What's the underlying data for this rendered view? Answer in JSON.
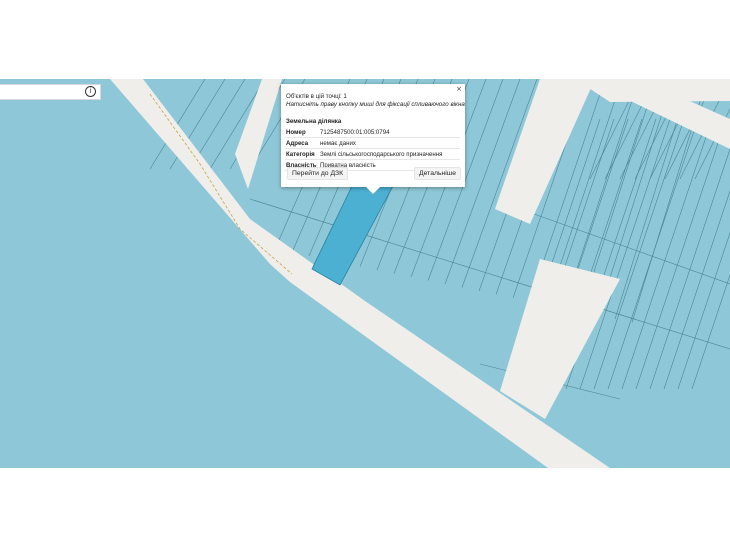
{
  "map": {
    "water_color": "#8ec8d8",
    "road_color": "#f0eeea",
    "highlight_color": "#4bb0d2",
    "parcel_line_color": "#4a8597"
  },
  "search": {
    "info_icon": "info-icon",
    "info_glyph": "i"
  },
  "popup": {
    "close_glyph": "×",
    "objects_line": "Об'єктів в цій точці: 1",
    "hint": "Натисніть праву кнопку миші для фіксації спливаючого вікна",
    "section_title": "Земельна ділянка",
    "rows": [
      {
        "key": "Номер",
        "value": "7125487500:01:005:0794"
      },
      {
        "key": "Адреса",
        "value": "немає даних"
      },
      {
        "key": "Категорія",
        "value": "Землі сільськогосподарського призначення"
      },
      {
        "key": "Власність",
        "value": "Приватна власність"
      }
    ],
    "button_dzk": "Перейти до ДЗК",
    "button_details": "Детальніше"
  }
}
